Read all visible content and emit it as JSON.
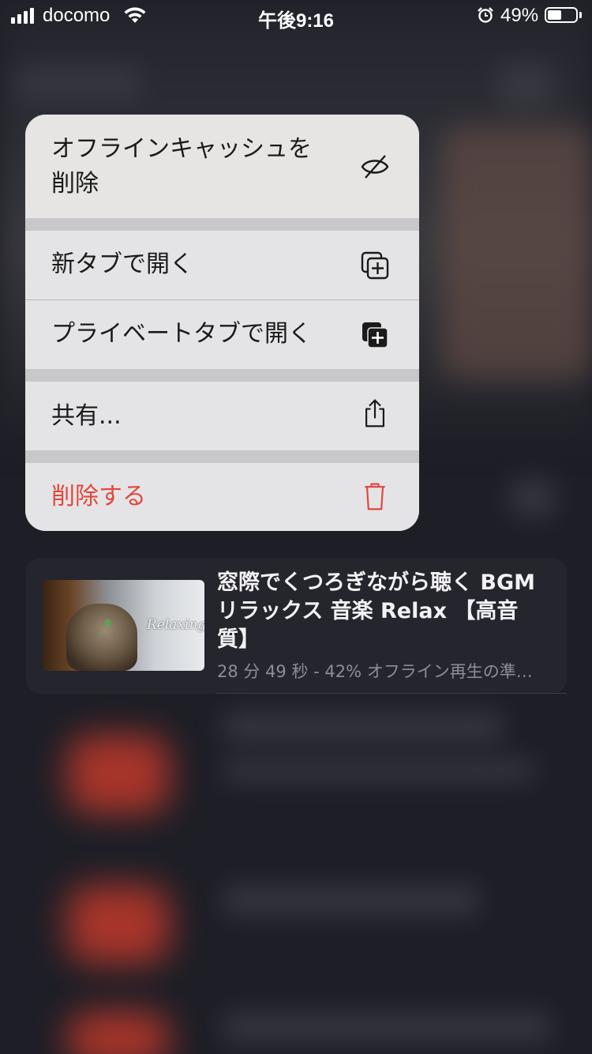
{
  "status_bar": {
    "carrier": "docomo",
    "time": "午後9:16",
    "battery_percent_text": "49%",
    "battery_level": 0.49
  },
  "context_menu": {
    "items": [
      {
        "label": "オフラインキャッシュを\n削除",
        "icon": "eye-slash-icon"
      },
      {
        "label": "新タブで開く",
        "icon": "new-tab-icon"
      },
      {
        "label": "プライベートタブで開く",
        "icon": "private-tab-icon"
      },
      {
        "label": "共有...",
        "icon": "share-icon"
      },
      {
        "label": "削除する",
        "icon": "trash-icon",
        "color": "#e2473d"
      }
    ]
  },
  "video": {
    "title": "窓際でくつろぎながら聴く BGM リラックス 音楽 Relax 【高音質】",
    "meta": "28 分 49 秒 - 42% オフライン再生の準…",
    "thumbnail_text": "Relaxing"
  }
}
